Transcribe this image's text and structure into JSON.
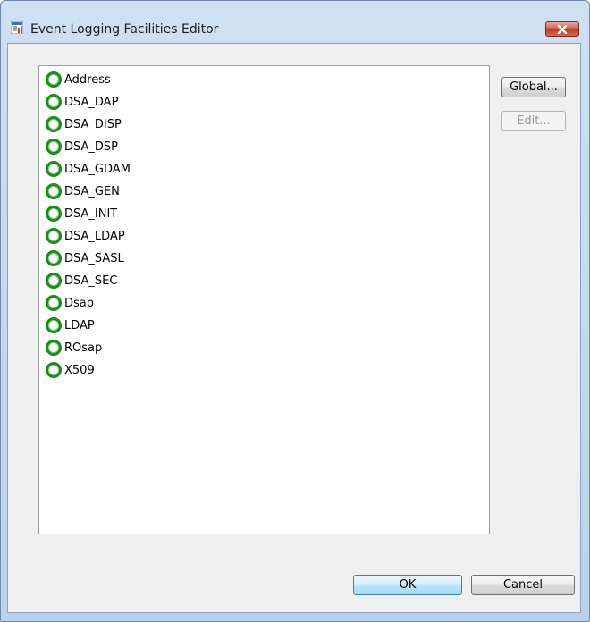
{
  "window": {
    "title": "Event Logging Facilities Editor",
    "close_icon": "close-icon"
  },
  "facilities": [
    {
      "label": "Address",
      "icon": "status-circle-green-icon"
    },
    {
      "label": "DSA_DAP",
      "icon": "status-circle-green-icon"
    },
    {
      "label": "DSA_DISP",
      "icon": "status-circle-green-icon"
    },
    {
      "label": "DSA_DSP",
      "icon": "status-circle-green-icon"
    },
    {
      "label": "DSA_GDAM",
      "icon": "status-circle-green-icon"
    },
    {
      "label": "DSA_GEN",
      "icon": "status-circle-green-icon"
    },
    {
      "label": "DSA_INIT",
      "icon": "status-circle-green-icon"
    },
    {
      "label": "DSA_LDAP",
      "icon": "status-circle-green-icon"
    },
    {
      "label": "DSA_SASL",
      "icon": "status-circle-green-icon"
    },
    {
      "label": "DSA_SEC",
      "icon": "status-circle-green-icon"
    },
    {
      "label": "Dsap",
      "icon": "status-circle-green-icon"
    },
    {
      "label": "LDAP",
      "icon": "status-circle-green-icon"
    },
    {
      "label": "ROsap",
      "icon": "status-circle-green-icon"
    },
    {
      "label": "X509",
      "icon": "status-circle-green-icon"
    }
  ],
  "buttons": {
    "global": "Global...",
    "edit": "Edit...",
    "ok": "OK",
    "cancel": "Cancel"
  },
  "colors": {
    "status_green": "#1c8c1c",
    "frame": "#b9d1ec",
    "close_red": "#c13d22"
  }
}
